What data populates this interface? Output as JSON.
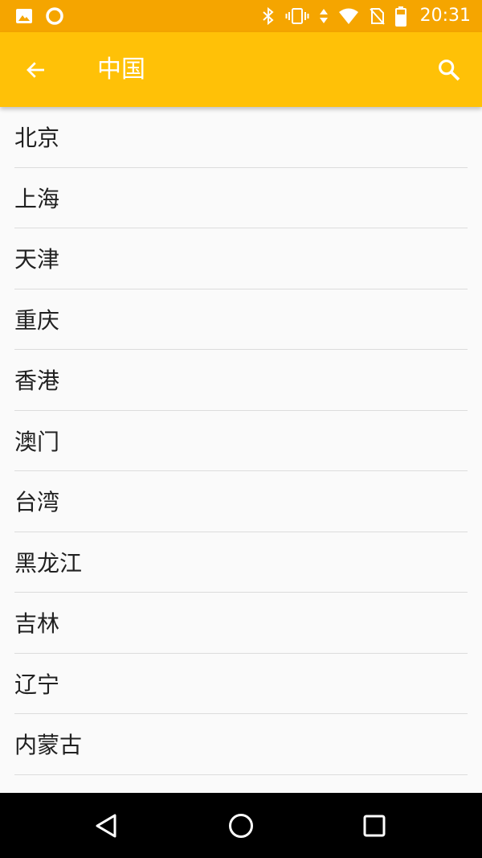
{
  "status_bar": {
    "time": "20:31",
    "background_color": "#f5a500",
    "left_icons": [
      "image-notification-icon",
      "circle-notification-icon"
    ],
    "right_icons": [
      "bluetooth-icon",
      "vibrate-icon",
      "data-arrows-icon",
      "wifi-icon",
      "no-sim-icon",
      "battery-icon"
    ]
  },
  "app_bar": {
    "title": "中国",
    "background_color": "#ffc107",
    "back_icon": "arrow-back-icon",
    "search_icon": "search-icon"
  },
  "regions": [
    {
      "label": "北京"
    },
    {
      "label": "上海"
    },
    {
      "label": "天津"
    },
    {
      "label": "重庆"
    },
    {
      "label": "香港"
    },
    {
      "label": "澳门"
    },
    {
      "label": "台湾"
    },
    {
      "label": "黑龙江"
    },
    {
      "label": "吉林"
    },
    {
      "label": "辽宁"
    },
    {
      "label": "内蒙古"
    }
  ],
  "nav_bar": {
    "buttons": [
      "nav-back-icon",
      "nav-home-icon",
      "nav-recents-icon"
    ]
  }
}
